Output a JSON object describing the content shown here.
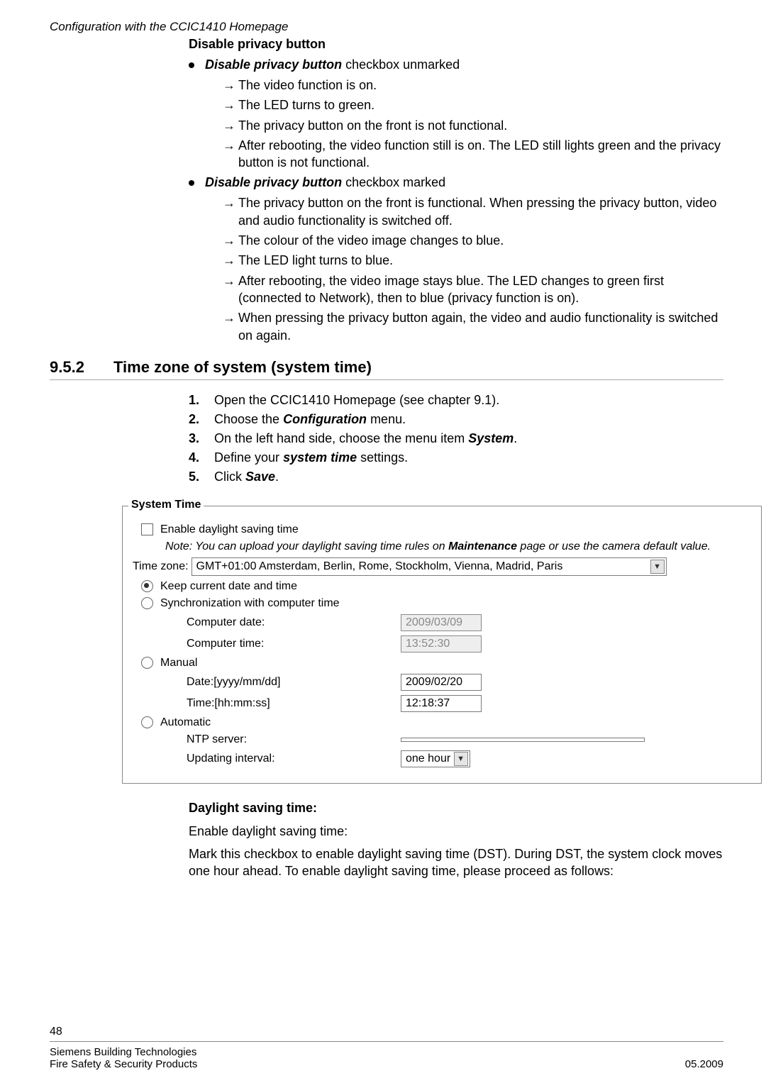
{
  "header": {
    "running": "Configuration with the CCIC1410 Homepage"
  },
  "s1": {
    "title": "Disable privacy button",
    "b1_pre": "Disable privacy button",
    "b1_post": " checkbox unmarked",
    "b1_a": "The video function is on.",
    "b1_b": "The LED turns to green.",
    "b1_c": "The privacy button on the front is not functional.",
    "b1_d": "After rebooting, the video function still is on. The LED still lights green and the privacy button is not functional.",
    "b2_pre": "Disable privacy button",
    "b2_post": " checkbox marked",
    "b2_a": "The privacy button on the front is functional. When pressing the privacy button, video and audio functionality is switched off.",
    "b2_b": "The colour of the video image changes to blue.",
    "b2_c": "The LED light turns to blue.",
    "b2_d": "After rebooting, the video image stays blue. The LED changes to green first (connected to Network), then to blue (privacy function is on).",
    "b2_e": "When pressing the privacy button again, the video and audio functionality is switched on again."
  },
  "section": {
    "num": "9.5.2",
    "title": "Time zone of system (system time)"
  },
  "steps": {
    "s1_num": "1.",
    "s1": "Open the CCIC1410 Homepage (see chapter 9.1).",
    "s2_num": "2.",
    "s2_pre": "Choose the ",
    "s2_bi": "Configuration",
    "s2_post": " menu.",
    "s3_num": "3.",
    "s3_pre": "On the left hand side, choose the menu item ",
    "s3_bi": "System",
    "s3_post": ".",
    "s4_num": "4.",
    "s4_pre": "Define your ",
    "s4_bi": "system time",
    "s4_post": " settings.",
    "s5_num": "5.",
    "s5_pre": "Click ",
    "s5_bi": "Save",
    "s5_post": "."
  },
  "form": {
    "legend": "System Time",
    "dst_label": "Enable daylight saving time",
    "dst_note_pre": "Note: You can upload your daylight saving time rules on ",
    "dst_note_b": "Maintenance",
    "dst_note_post": " page or use the camera default value.",
    "tz_label": "Time zone:",
    "tz_value": "GMT+01:00 Amsterdam, Berlin, Rome, Stockholm, Vienna, Madrid, Paris",
    "r_keep": "Keep current date and time",
    "r_sync": "Synchronization with computer time",
    "comp_date_label": "Computer date:",
    "comp_date": "2009/03/09",
    "comp_time_label": "Computer time:",
    "comp_time": "13:52:30",
    "r_manual": "Manual",
    "man_date_label": "Date:[yyyy/mm/dd]",
    "man_date": "2009/02/20",
    "man_time_label": "Time:[hh:mm:ss]",
    "man_time": "12:18:37",
    "r_auto": "Automatic",
    "ntp_label": "NTP server:",
    "ntp_value": "",
    "upd_label": "Updating interval:",
    "upd_value": "one hour"
  },
  "post": {
    "h": "Daylight saving time:",
    "p1": "Enable daylight saving time:",
    "p2": "Mark this checkbox to enable daylight saving time (DST). During DST, the system clock moves one hour ahead. To enable daylight saving time, please proceed as follows:"
  },
  "footer": {
    "page": "48",
    "line1": "Siemens Building Technologies",
    "line2_left": "Fire Safety & Security Products",
    "line2_right": "05.2009"
  }
}
